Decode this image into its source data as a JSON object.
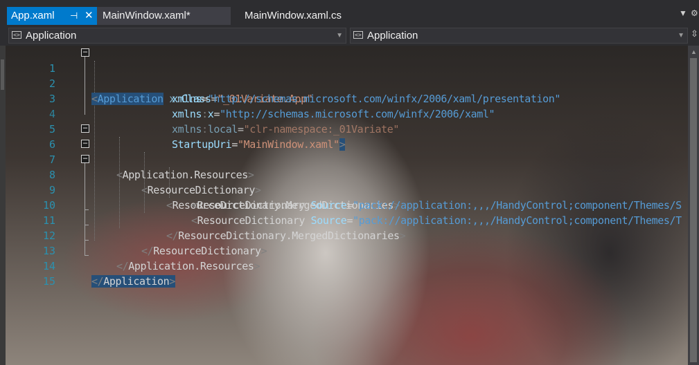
{
  "tabs": [
    {
      "label": "App.xaml",
      "active": true,
      "pin_icon": "pin-icon",
      "close_icon": "close-icon"
    },
    {
      "label": "MainWindow.xaml*",
      "active": false
    },
    {
      "label": "MainWindow.xaml.cs",
      "active": false
    }
  ],
  "navbar": {
    "left_combo": "Application",
    "right_combo": "Application"
  },
  "colors": {
    "accent": "#007acc",
    "line_number": "#2b91af",
    "xml_tag": "#569cd6",
    "xml_attr": "#9cdcfe",
    "xml_string": "#ce9178",
    "selection": "#264f78"
  },
  "editor": {
    "line_numbers": [
      "1",
      "2",
      "3",
      "4",
      "5",
      "6",
      "7",
      "8",
      "9",
      "10",
      "11",
      "12",
      "13",
      "14",
      "15"
    ],
    "code": {
      "l1": {
        "lt": "<",
        "tag": "Application",
        "attr_prefix": "x",
        "colon": ":",
        "attr": "Class",
        "eq": "=",
        "val": "\"_01Variate.App\""
      },
      "l2": {
        "attr": "xmlns",
        "eq": "=",
        "val": "\"http://schemas.microsoft.com/winfx/2006/xaml/presentation\""
      },
      "l3": {
        "attr": "xmlns",
        "colon": ":",
        "attr2": "x",
        "eq": "=",
        "val": "\"http://schemas.microsoft.com/winfx/2006/xaml\""
      },
      "l4": {
        "attr": "xmlns",
        "colon": ":",
        "attr2": "local",
        "eq": "=",
        "val": "\"clr-namespace:_01Variate\""
      },
      "l5": {
        "attr": "StartupUri",
        "eq": "=",
        "val": "\"MainWindow.xaml\"",
        "gt": ">"
      },
      "l6": {
        "lt": "<",
        "tag": "Application.Resources",
        "gt": ">"
      },
      "l7": {
        "lt": "<",
        "tag": "ResourceDictionary",
        "gt": ">"
      },
      "l8": {
        "lt": "<",
        "tag": "ResourceDictionary.MergedDictionaries",
        "gt": ">"
      },
      "l9": {
        "lt": "<",
        "tag": "ResourceDictionary",
        "attr": "Source",
        "eq": "=",
        "val": "\"pack://application:,,,/HandyControl;component/Themes/S"
      },
      "l10": {
        "lt": "<",
        "tag": "ResourceDictionary",
        "attr": "Source",
        "eq": "=",
        "val": "\"pack://application:,,,/HandyControl;component/Themes/T"
      },
      "l11": {
        "lt": "</",
        "tag": "ResourceDictionary.MergedDictionaries",
        "gt": ">"
      },
      "l12": {
        "lt": "</",
        "tag": "ResourceDictionary",
        "gt": ">"
      },
      "l13": {
        "lt": "</",
        "tag": "Application.Resources",
        "gt": ">"
      },
      "l14": {
        "lt": "</",
        "tag": "Application",
        "gt": ">"
      }
    }
  }
}
